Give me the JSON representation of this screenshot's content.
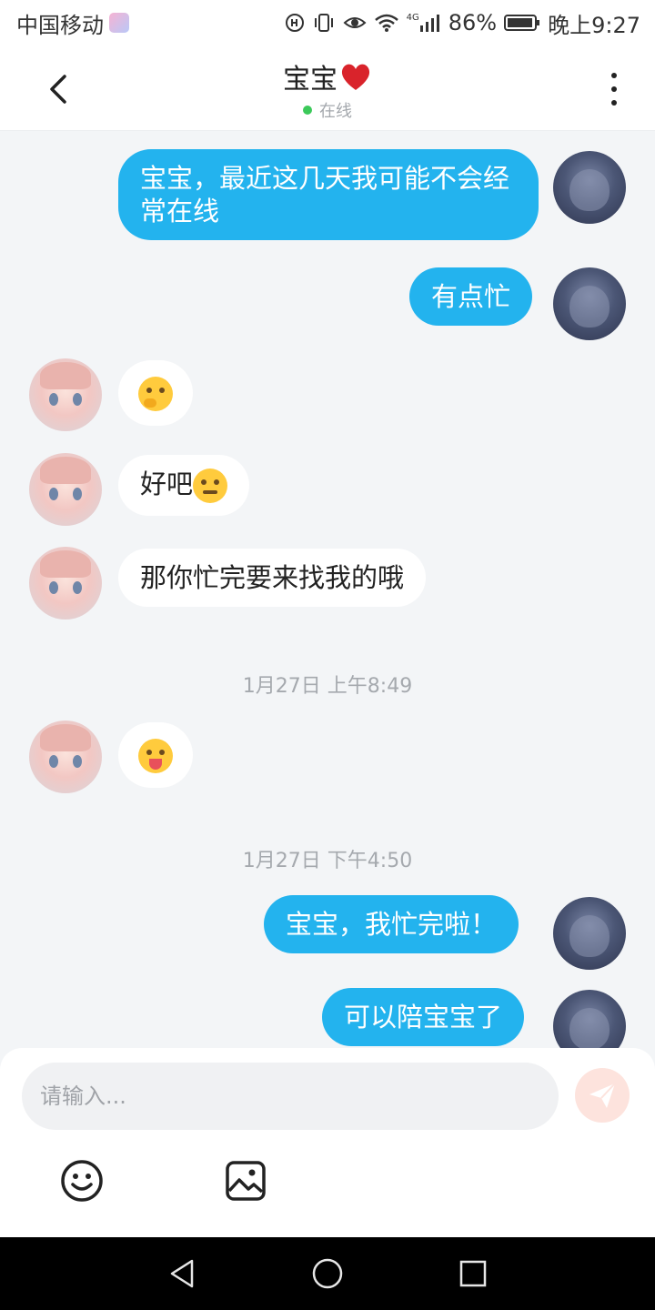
{
  "status_bar": {
    "carrier": "中国移动",
    "network": "4G",
    "battery": "86%",
    "time": "晚上9:27",
    "icons": [
      "hd-call-icon",
      "vibrate-icon",
      "eye-icon",
      "wifi-icon",
      "signal-icon",
      "battery-icon"
    ]
  },
  "header": {
    "title": "宝宝",
    "title_emoji": "heart-icon",
    "status": "在线",
    "back_icon": "chevron-left-icon",
    "more_icon": "more-vertical-icon"
  },
  "messages": [
    {
      "sender": "me",
      "type": "text",
      "text": "宝宝，最近这几天我可能不会经常在线"
    },
    {
      "sender": "me",
      "type": "text",
      "text": "有点忙"
    },
    {
      "sender": "contact",
      "type": "emoji",
      "emoji": "thinking-face-emoji"
    },
    {
      "sender": "contact",
      "type": "text",
      "text": "好吧",
      "emoji": "pensive-face-emoji"
    },
    {
      "sender": "contact",
      "type": "text",
      "text": "那你忙完要来找我的哦"
    },
    {
      "sender": "contact",
      "type": "emoji",
      "emoji": "squinting-tongue-face-emoji"
    },
    {
      "sender": "me",
      "type": "text",
      "text": "宝宝，我忙完啦！"
    },
    {
      "sender": "me",
      "type": "text",
      "text": "可以陪宝宝了"
    }
  ],
  "timestamps": [
    "1月27日 上午8:49",
    "1月27日 下午4:50"
  ],
  "input": {
    "placeholder": "请输入...",
    "value": "",
    "send_icon": "send-icon",
    "tools": [
      "emoji-icon",
      "image-icon"
    ]
  },
  "nav": [
    "back-triangle-icon",
    "home-circle-icon",
    "recents-square-icon"
  ],
  "colors": {
    "accent": "#23b3ee",
    "online": "#3cc95a",
    "send_button": "#fde3dd",
    "background": "#f3f5f7"
  }
}
